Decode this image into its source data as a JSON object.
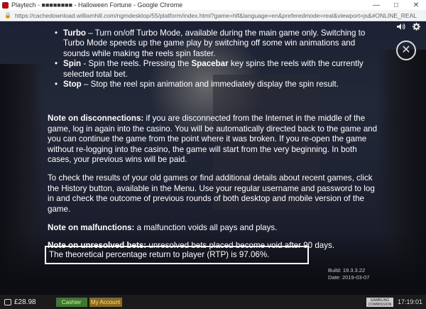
{
  "window": {
    "title": "Playtech - ■■■■■■■■ - Halloween Fortune - Google Chrome",
    "controls": [
      "—",
      "□",
      "✕"
    ]
  },
  "address": {
    "url": "https://cachedownload.williamhill.com/ngmdesktop/55/platform/index.html?game=hlf&language=en&preferedmode=real&viewport=js&#ONLINE_REAL"
  },
  "game_ui": {
    "sound_icon": "speaker-icon",
    "settings_icon": "gear-icon",
    "close_glyph": "✕"
  },
  "help": {
    "turbo_term": "Turbo",
    "turbo_desc": " – Turn on/off Turbo Mode, available during the main game only. Switching to Turbo Mode speeds up the game play by switching off some win animations and sounds while making the reels spin faster.",
    "spin_term": "Spin",
    "spin_desc_a": " - Spin the reels. Pressing the ",
    "spin_key": "Spacebar",
    "spin_desc_b": " key spins the reels with the currently selected total bet.",
    "stop_term": "Stop",
    "stop_desc": " – Stop the reel spin animation and immediately display the spin result.",
    "disc_term": "Note on disconnections:",
    "disc_desc": " if you are disconnected from the Internet in the middle of the game, log in again into the casino. You will be automatically directed back to the game and you can continue the game from the point where it was broken. If you re-open the game without re-logging into the casino, the game will start from the very beginning. In both cases, your previous wins will be paid.",
    "history": "To check the results of your old games or find additional details about recent games, click the History button, available in the Menu. Use your regular username and password to log in and check the outcome of previous rounds of both desktop and mobile version of the game.",
    "malf_term": "Note on malfunctions:",
    "malf_desc": " a malfunction voids all pays and plays.",
    "unres_term": "Note on unresolved bets:",
    "unres_desc": " unresolved bets placed become void after 90 days.",
    "rtp": "The theoretical percentage return to player (RTP) is 97.06%.",
    "build": "Build:  19.3.3.22",
    "date": "Date:  2019-03-07"
  },
  "bottom": {
    "balance": "£28.98",
    "cashier": "Cashier",
    "my_account": "My Account",
    "gc_logo": "GAMBLING COMMISSION",
    "time": "17:19:01"
  }
}
